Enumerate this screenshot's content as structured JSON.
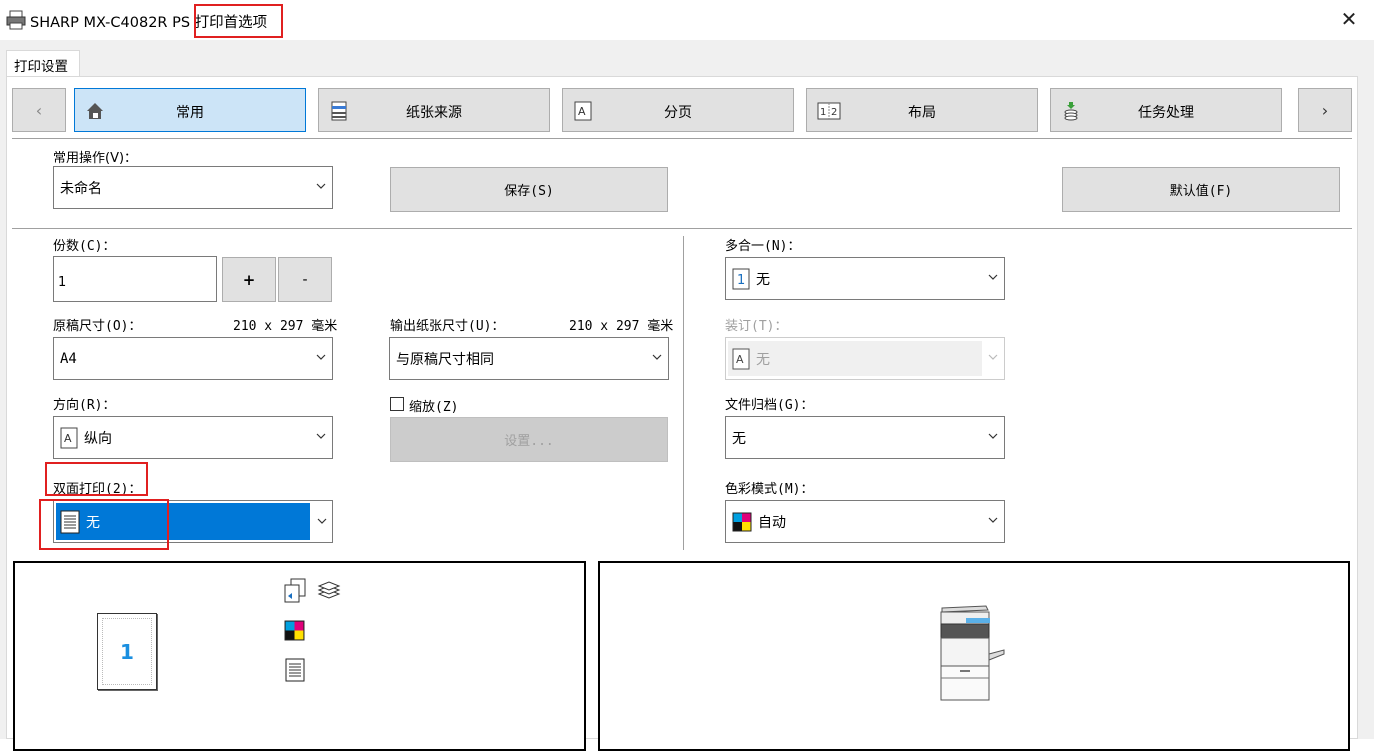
{
  "window": {
    "printer_name": "SHARP MX-C4082R PS",
    "title_suffix": "打印首选项",
    "close_glyph": "✕"
  },
  "tab": {
    "label": "打印设置"
  },
  "nav": {
    "prev_glyph": "‹",
    "next_glyph": "›",
    "items": [
      {
        "label": "常用",
        "icon": "home-icon",
        "selected": true
      },
      {
        "label": "纸张来源",
        "icon": "paper-tray-icon"
      },
      {
        "label": "分页",
        "icon": "page-a-icon"
      },
      {
        "label": "布局",
        "icon": "layout-12-icon"
      },
      {
        "label": "任务处理",
        "icon": "job-stack-icon"
      }
    ]
  },
  "favorites": {
    "label": "常用操作(V)：",
    "value": "未命名",
    "save_label": "保存(S)",
    "default_label": "默认值(F)"
  },
  "copies": {
    "label": "份数(C)：",
    "value": "1",
    "plus": "+",
    "minus": "-"
  },
  "original_size": {
    "label": "原稿尺寸(O)：",
    "dims": "210 x 297 毫米",
    "value": "A4"
  },
  "output_size": {
    "label": "输出纸张尺寸(U)：",
    "dims": "210 x 297 毫米",
    "value": "与原稿尺寸相同"
  },
  "orientation": {
    "label": "方向(R)：",
    "value": "纵向",
    "icon_letter": "A"
  },
  "zoom": {
    "label": "缩放(Z)",
    "checked": false,
    "settings_label": "设置..."
  },
  "duplex": {
    "label": "双面打印(2)：",
    "value": "无"
  },
  "n_up": {
    "label": "多合一(N)：",
    "value": "无",
    "icon_digit": "1"
  },
  "binding": {
    "label": "装订(T)：",
    "value": "无",
    "icon_letter": "A"
  },
  "file_retention": {
    "label": "文件归档(G)：",
    "value": "无"
  },
  "color_mode": {
    "label": "色彩模式(M)：",
    "value": "自动"
  },
  "preview": {
    "page_number": "1"
  },
  "colors": {
    "selection_blue": "#0078d7",
    "nav_selected_bg": "#cce4f7",
    "highlight_red": "#e02020",
    "page_number_blue": "#1a8fe0"
  }
}
